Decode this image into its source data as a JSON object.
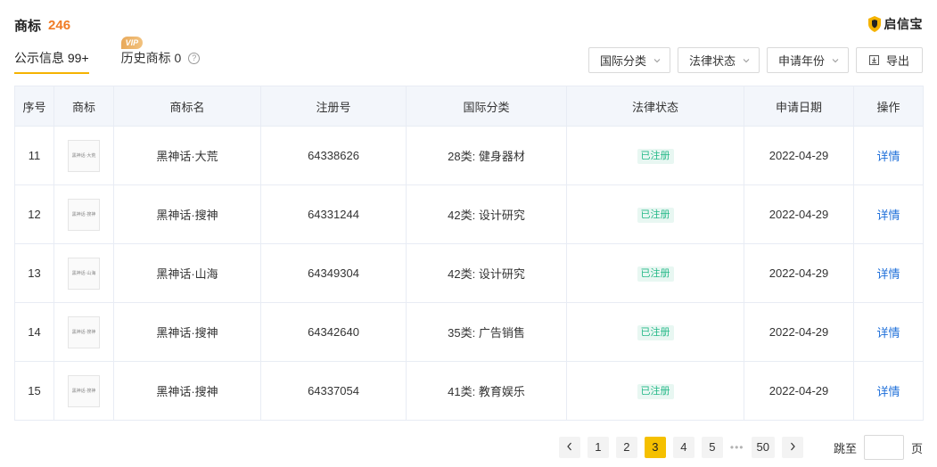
{
  "header": {
    "title": "商标",
    "count": "246"
  },
  "brand": {
    "name": "启信宝",
    "accent": "#f5b301"
  },
  "tabs": [
    {
      "label": "公示信息 99+",
      "active": true
    },
    {
      "label": "历史商标 0",
      "badge": "VIP",
      "active": false
    }
  ],
  "filters": [
    {
      "label": "国际分类"
    },
    {
      "label": "法律状态"
    },
    {
      "label": "申请年份"
    }
  ],
  "export_label": "导出",
  "table": {
    "columns": [
      "序号",
      "商标",
      "商标名",
      "注册号",
      "国际分类",
      "法律状态",
      "申请日期",
      "操作"
    ],
    "rows": [
      {
        "index": "11",
        "thumb_text": "黑神话·大荒",
        "name": "黑神话·大荒",
        "reg_no": "64338626",
        "category": "28类: 健身器材",
        "status": "已注册",
        "date": "2022-04-29",
        "action": "详情"
      },
      {
        "index": "12",
        "thumb_text": "黑神话·搜神",
        "name": "黑神话·搜神",
        "reg_no": "64331244",
        "category": "42类: 设计研究",
        "status": "已注册",
        "date": "2022-04-29",
        "action": "详情"
      },
      {
        "index": "13",
        "thumb_text": "黑神话·山海",
        "name": "黑神话·山海",
        "reg_no": "64349304",
        "category": "42类: 设计研究",
        "status": "已注册",
        "date": "2022-04-29",
        "action": "详情"
      },
      {
        "index": "14",
        "thumb_text": "黑神话·搜神",
        "name": "黑神话·搜神",
        "reg_no": "64342640",
        "category": "35类: 广告销售",
        "status": "已注册",
        "date": "2022-04-29",
        "action": "详情"
      },
      {
        "index": "15",
        "thumb_text": "黑神话·搜神",
        "name": "黑神话·搜神",
        "reg_no": "64337054",
        "category": "41类: 教育娱乐",
        "status": "已注册",
        "date": "2022-04-29",
        "action": "详情"
      }
    ]
  },
  "pagination": {
    "pages": [
      "1",
      "2",
      "3",
      "4",
      "5"
    ],
    "current": "3",
    "ellipsis": "•••",
    "last": "50",
    "goto_label": "跳至",
    "goto_value": "",
    "suffix": "页"
  },
  "colors": {
    "count": "#f07b25",
    "link": "#1e6fd9",
    "status_text": "#27b989",
    "status_bg": "#e8f7f2",
    "active_page": "#f5c000"
  }
}
